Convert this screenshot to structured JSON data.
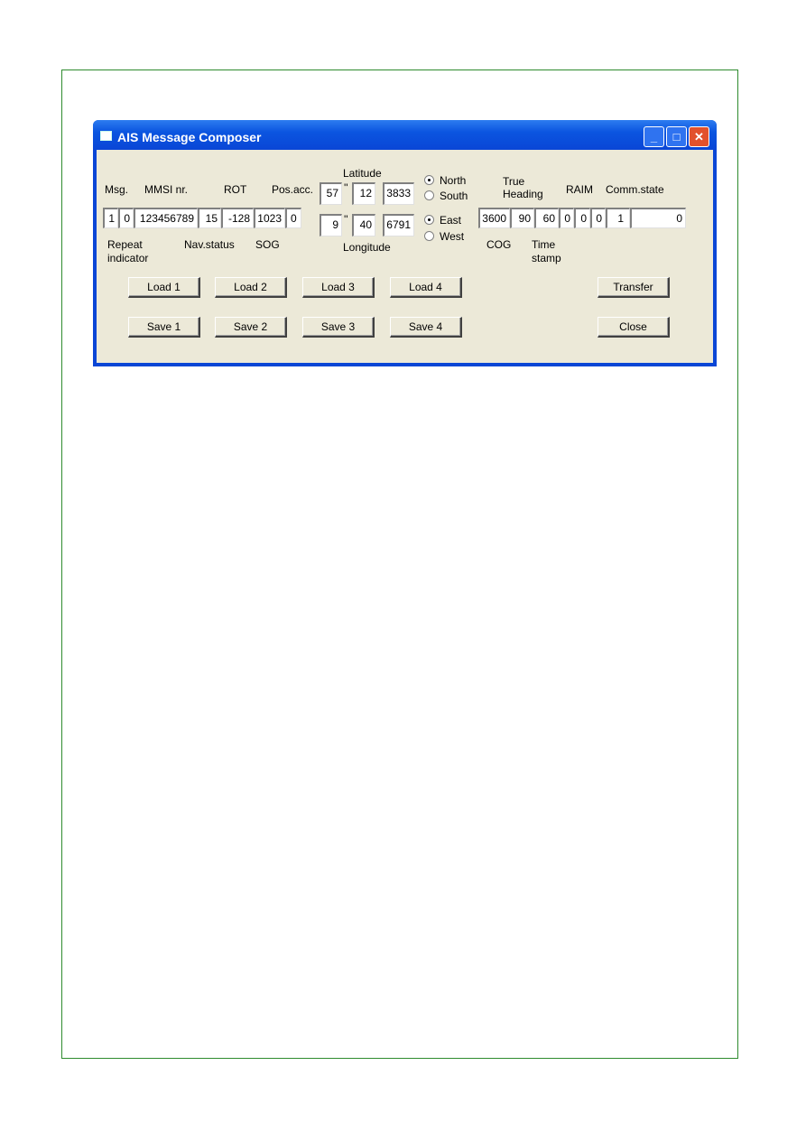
{
  "window": {
    "title": "AIS Message Composer",
    "controls": [
      "minimize",
      "maximize",
      "close"
    ]
  },
  "labels": {
    "msg": "Msg.",
    "mmsi": "MMSI nr.",
    "rot": "ROT",
    "pos_acc": "Pos.acc.",
    "latitude": "Latitude",
    "longitude": "Longitude",
    "true": "True",
    "heading": "Heading",
    "raim": "RAIM",
    "comm_state": "Comm.state",
    "repeat": "Repeat",
    "indicator": "indicator",
    "nav_status": "Nav.status",
    "sog": "SOG",
    "cog": "COG",
    "time": "Time",
    "stamp": "stamp",
    "deg_mark": "''"
  },
  "fields": {
    "msg": "1",
    "repeat": "0",
    "mmsi": "123456789",
    "nav_status": "15",
    "rot": "-128",
    "sog": "1023",
    "pos_acc": "0",
    "lat_deg": "57",
    "lat_min": "12",
    "lat_frac": "3833",
    "lon_deg": "9",
    "lon_min": "40",
    "lon_frac": "6791",
    "cog": "3600",
    "true_heading": "90",
    "time_stamp": "60",
    "f1": "0",
    "f2": "0",
    "raim": "0",
    "f3": "1",
    "comm_state": "0"
  },
  "radios": {
    "north": "North",
    "south": "South",
    "east": "East",
    "west": "West",
    "lat_selected": "North",
    "lon_selected": "East"
  },
  "buttons": {
    "load1": "Load 1",
    "load2": "Load 2",
    "load3": "Load 3",
    "load4": "Load 4",
    "save1": "Save 1",
    "save2": "Save 2",
    "save3": "Save 3",
    "save4": "Save 4",
    "transfer": "Transfer",
    "close": "Close"
  }
}
